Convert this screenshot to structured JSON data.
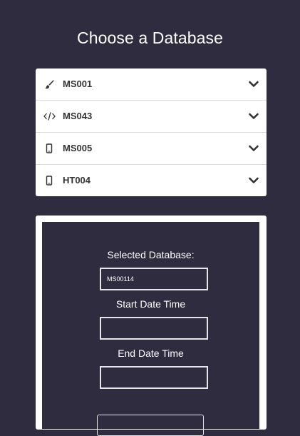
{
  "page": {
    "title": "Choose a Database"
  },
  "databases": [
    {
      "label": "MS001",
      "icon": "brush-icon"
    },
    {
      "label": "MS043",
      "icon": "code-icon"
    },
    {
      "label": "MS005",
      "icon": "mobile-icon"
    },
    {
      "label": "HT004",
      "icon": "mobile-icon"
    }
  ],
  "form": {
    "selected_label": "Selected Database:",
    "selected_value": "MS00114",
    "start_label": "Start Date Time",
    "start_value": "",
    "end_label": "End Date Time",
    "end_value": "",
    "submit_label": ""
  },
  "colors": {
    "background": "#2e2c3e",
    "panel": "#ffffff",
    "text_dark": "#333333"
  }
}
